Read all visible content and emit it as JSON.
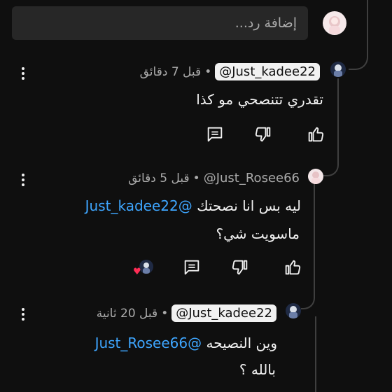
{
  "reply": {
    "placeholder": "إضافة رد..."
  },
  "comments": [
    {
      "author": "@Just_kadee22",
      "separator": "•",
      "time": "قبل 7 دقائق",
      "text": "تقدري تتنصحي مو كذا"
    },
    {
      "author": "@Just_Rosee66",
      "separator": "•",
      "time": "قبل 5 دقائق",
      "line1_text": "ليه بس انا نصحتك ",
      "line1_mention": "@Just_kadee22",
      "line2": "ماسويت شي؟"
    },
    {
      "author": "@Just_kadee22",
      "separator": "•",
      "time": "قبل 20 ثانية",
      "line1_text": "وين النصيحه ",
      "line1_mention": "@Just_Rosee66",
      "line2": "بالله ؟"
    }
  ],
  "icons": {
    "like": "thumb-up-icon",
    "dislike": "thumb-down-icon",
    "reply": "comment-icon",
    "more": "more-vertical-icon",
    "creator_heart": "heart-icon"
  },
  "colors": {
    "background": "#0f0f0f",
    "input": "#272727",
    "text": "#f1f1f1",
    "muted": "#aaaaaa",
    "mention": "#3ea6ff",
    "heart": "#ff2d55"
  }
}
